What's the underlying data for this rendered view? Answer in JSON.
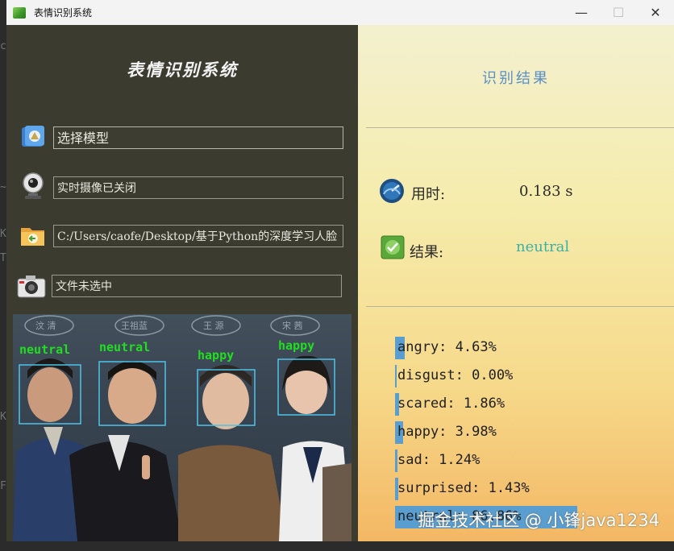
{
  "window": {
    "title": "表情识别系统",
    "min": "—",
    "max": "☐",
    "close": "✕"
  },
  "left": {
    "app_title": "表情识别系统",
    "model_field": "选择模型",
    "camera_field": "实时摄像已关闭",
    "folder_field": "C:/Users/caofe/Desktop/基于Python的深度学习人脸",
    "file_field": "文件未选中"
  },
  "photo": {
    "labels": [
      "neutral",
      "neutral",
      "happy",
      "happy"
    ],
    "banners": [
      "汶 清",
      "王祖蓝",
      "王 源",
      "宋 茜"
    ]
  },
  "right": {
    "title": "识别结果",
    "time_label": "用时:",
    "time_value": "0.183 s",
    "result_label": "结果:",
    "result_value": "neutral",
    "probabilities": [
      {
        "text": "angry: 4.63%",
        "value": 4.63
      },
      {
        "text": "disgust: 0.00%",
        "value": 0.0
      },
      {
        "text": "scared: 1.86%",
        "value": 1.86
      },
      {
        "text": "happy: 3.98%",
        "value": 3.98
      },
      {
        "text": "sad: 1.24%",
        "value": 1.24
      },
      {
        "text": "surprised: 1.43%",
        "value": 1.43
      },
      {
        "text": "neutral: 86.86%",
        "value": 86.86
      }
    ]
  },
  "watermark": "掘金技术社区 @ 小锋java1234",
  "colors": {
    "left_bg": "#3b3b2f",
    "bar": "#5a9ed0",
    "face_box": "#4fc3e8",
    "face_label": "#22dd22",
    "result_accent": "#3bb0a8"
  }
}
